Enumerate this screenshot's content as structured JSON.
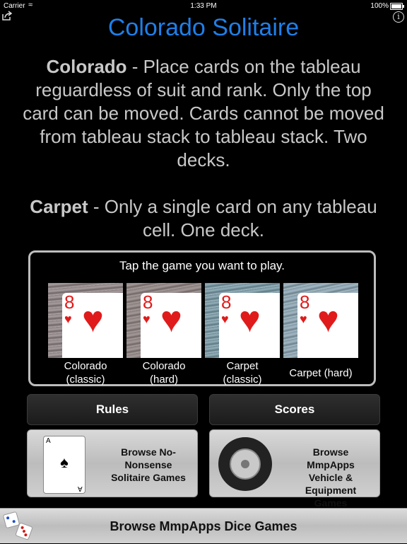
{
  "status_bar": {
    "carrier": "Carrier",
    "time": "1:33 PM",
    "battery": "100%",
    "battery_level": 1.0
  },
  "header": {
    "title": "Colorado Solitaire",
    "share_icon": "share-icon",
    "info_icon": "info-icon"
  },
  "descriptions": {
    "colorado_name": "Colorado",
    "colorado_text": " - Place cards on the tableau reguardless of suit and rank. Only the top card can be moved. Cards cannot be moved from tableau stack to tableau stack. Two decks.",
    "carpet_name": "Carpet",
    "carpet_text": " - Only a single card on any tableau cell. One deck."
  },
  "game_panel": {
    "prompt": "Tap the game you want to play.",
    "card_rank": "8",
    "card_suit": "♥",
    "games": [
      {
        "label": "Colorado\n(classic)"
      },
      {
        "label": "Colorado\n(hard)"
      },
      {
        "label": "Carpet\n(classic)"
      },
      {
        "label": "Carpet (hard)"
      }
    ]
  },
  "buttons": {
    "rules": "Rules",
    "scores": "Scores"
  },
  "promos": {
    "solitaire": {
      "text": "Browse No-Nonsense Solitaire Games",
      "card_rank": "A",
      "card_suit": "♠"
    },
    "vehicle": {
      "text": "Browse MmpApps Vehicle & Equipment Games"
    },
    "dice": {
      "text": "Browse MmpApps Dice Games"
    }
  },
  "colors": {
    "title": "#1f7fe8",
    "heart": "#e01b1b"
  }
}
